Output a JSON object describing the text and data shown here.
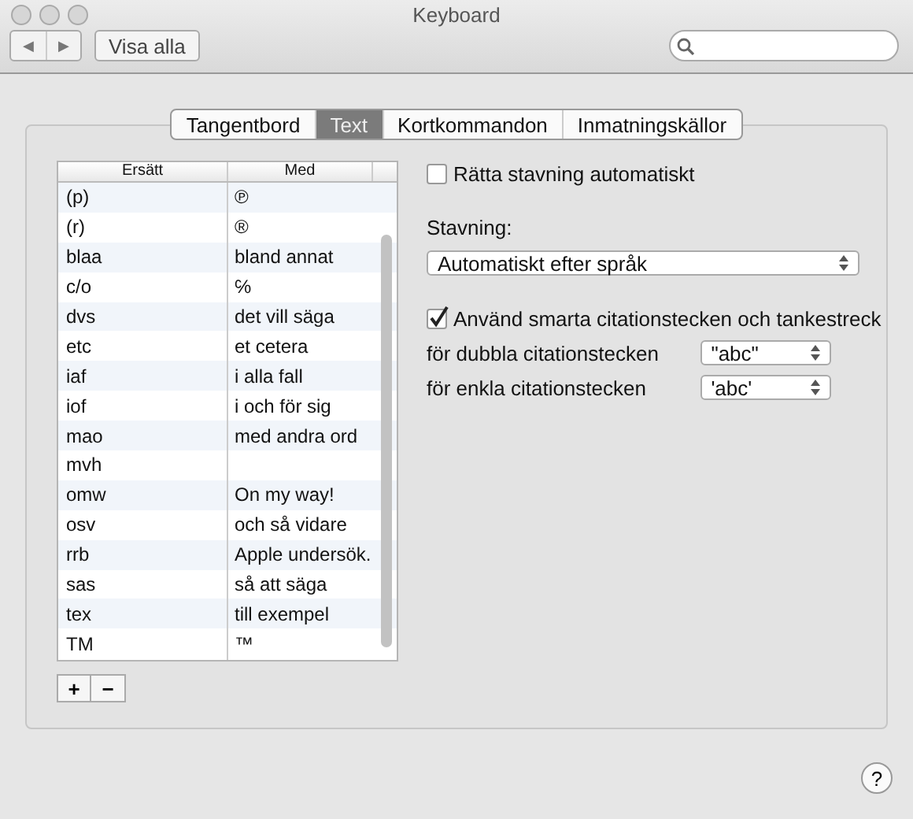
{
  "window": {
    "title": "Keyboard"
  },
  "toolbar": {
    "show_all": "Visa alla",
    "back": "◀",
    "forward": "▶"
  },
  "tabs": [
    {
      "label": "Tangentbord",
      "selected": false
    },
    {
      "label": "Text",
      "selected": true
    },
    {
      "label": "Kortkommandon",
      "selected": false
    },
    {
      "label": "Inmatningskällor",
      "selected": false
    }
  ],
  "table": {
    "columns": [
      "Ersätt",
      "Med"
    ],
    "rows": [
      {
        "replace": "(p)",
        "with": "℗"
      },
      {
        "replace": "(r)",
        "with": "®"
      },
      {
        "replace": "blaa",
        "with": "bland annat"
      },
      {
        "replace": "c/o",
        "with": "℅"
      },
      {
        "replace": "dvs",
        "with": "det vill säga"
      },
      {
        "replace": "etc",
        "with": "et cetera"
      },
      {
        "replace": "iaf",
        "with": "i alla fall"
      },
      {
        "replace": "iof",
        "with": "i och för sig"
      },
      {
        "replace": "mao",
        "with": "med andra ord"
      },
      {
        "replace": "mvh",
        "with": ""
      },
      {
        "replace": "omw",
        "with": "On my way!"
      },
      {
        "replace": "osv",
        "with": "och så vidare"
      },
      {
        "replace": "rrb",
        "with": "Apple undersök."
      },
      {
        "replace": "sas",
        "with": "så att säga"
      },
      {
        "replace": "tex",
        "with": "till exempel"
      },
      {
        "replace": "TM",
        "with": "™"
      }
    ]
  },
  "table_buttons": [
    "+",
    "−"
  ],
  "spelling_auto": {
    "label": "Rätta stavning automatiskt",
    "checked": false
  },
  "spelling": {
    "label": "Stavning:",
    "value": "Automatiskt efter språk"
  },
  "smart_quotes": {
    "label": "Använd smarta citationstecken och tankestreck",
    "checked": true
  },
  "quote_options": [
    {
      "label": "för dubbla citationstecken",
      "value": "\"abc\""
    },
    {
      "label": "för enkla citationstecken",
      "value": "'abc'"
    }
  ],
  "help": "?"
}
